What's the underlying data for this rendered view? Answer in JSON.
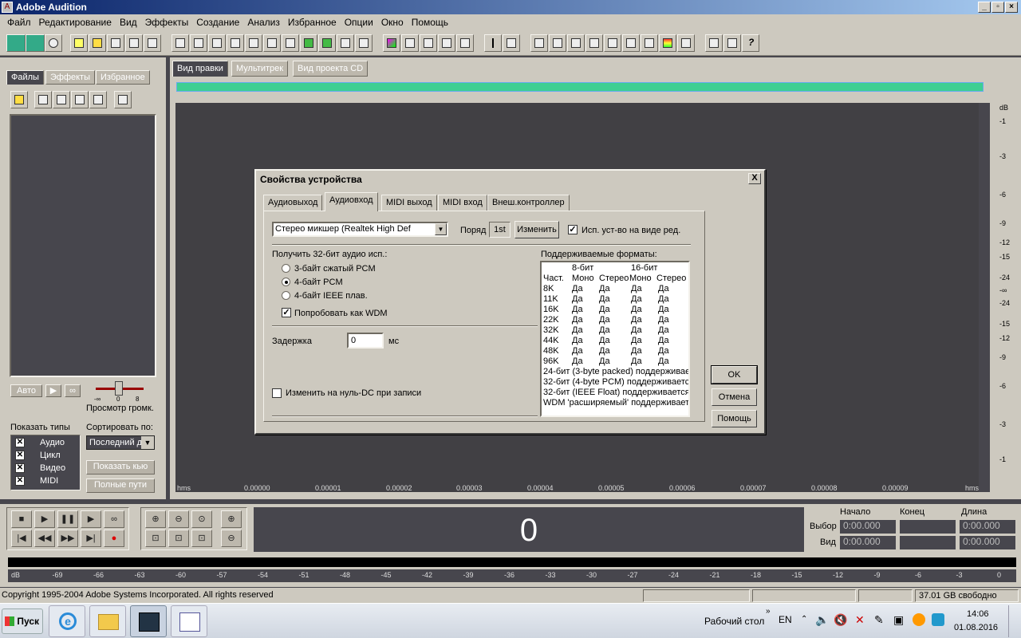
{
  "window": {
    "title": "Adobe Audition"
  },
  "menu": [
    "Файл",
    "Редактирование",
    "Вид",
    "Эффекты",
    "Создание",
    "Анализ",
    "Избранное",
    "Опции",
    "Окно",
    "Помощь"
  ],
  "left_panel": {
    "tabs": [
      "Файлы",
      "Эффекты",
      "Избранное"
    ],
    "auto_label": "Авто",
    "volume_label": "Просмотр громк.",
    "volume_scale": [
      "-∞",
      "0",
      "8"
    ],
    "show_types_label": "Показать типы",
    "sort_label": "Сортировать по:",
    "sort_value": "Последний д",
    "types": [
      "Аудио",
      "Цикл",
      "Видео",
      "MIDI"
    ],
    "show_button": "Показать кью",
    "paths_button": "Полные пути"
  },
  "main_tabs": [
    "Вид правки",
    "Мультитрек",
    "Вид проекта CD"
  ],
  "db_scale": [
    "dB",
    "-1",
    "-3",
    "-6",
    "-9",
    "-12",
    "-15",
    "-24",
    "-∞",
    "-24",
    "-15",
    "-12",
    "-9",
    "-6",
    "-3",
    "-1"
  ],
  "timeline": [
    "hms",
    "0.00000",
    "0.00001",
    "0.00002",
    "0.00003",
    "0.00004",
    "0.00005",
    "0.00006",
    "0.00007",
    "0.00008",
    "0.00009",
    "hms"
  ],
  "time_display": "0",
  "selection": {
    "headers": [
      "Начало",
      "Конец",
      "Длина"
    ],
    "rows": [
      {
        "label": "Выбор",
        "values": [
          "0:00.000",
          "",
          "0:00.000"
        ]
      },
      {
        "label": "Вид",
        "values": [
          "0:00.000",
          "",
          "0:00.000"
        ]
      }
    ]
  },
  "meter_scale": [
    "dB",
    "-69",
    "-66",
    "-63",
    "-60",
    "-57",
    "-54",
    "-51",
    "-48",
    "-45",
    "-42",
    "-39",
    "-36",
    "-33",
    "-30",
    "-27",
    "-24",
    "-21",
    "-18",
    "-15",
    "-12",
    "-9",
    "-6",
    "-3",
    "0"
  ],
  "status": {
    "copyright": "Copyright 1995-2004 Adobe Systems Incorporated. All rights reserved",
    "free_space": "37.01 GB свободно"
  },
  "taskbar": {
    "start": "Пуск",
    "desktop": "Рабочий стол",
    "lang": "EN",
    "time": "14:06",
    "date": "01.08.2016"
  },
  "dialog": {
    "title": "Свойства устройства",
    "close": "X",
    "tabs": [
      "Аудиовыход",
      "Аудиовход",
      "MIDI выход",
      "MIDI вход",
      "Внеш.контроллер"
    ],
    "active_tab": 1,
    "device_select": "Стерео микшер (Realtek High Def",
    "order_label": "Поряд",
    "order_value": "1st",
    "change_button": "Изменить",
    "use_device_label": "Исп. уст-во на виде ред.",
    "receive_label": "Получить 32-бит аудио исп.:",
    "radios": [
      "3-байт сжатый PCM",
      "4-байт PCM",
      "4-байт IEEE плав."
    ],
    "radio_selected": 1,
    "wdm_label": "Попробовать как WDM",
    "latency_label": "Задержка",
    "latency_value": "0",
    "latency_unit": "мс",
    "dc_label": "Изменить на нуль-DC при записи",
    "formats_label": "Поддерживаемые форматы:",
    "formats_header1": [
      "8-бит",
      "16-бит"
    ],
    "formats_header2": [
      "Част.",
      "Моно",
      "Стерео",
      "Моно",
      "Стерео"
    ],
    "formats_rows": [
      [
        "8K",
        "Да",
        "Да",
        "Да",
        "Да"
      ],
      [
        "11K",
        "Да",
        "Да",
        "Да",
        "Да"
      ],
      [
        "16K",
        "Да",
        "Да",
        "Да",
        "Да"
      ],
      [
        "22K",
        "Да",
        "Да",
        "Да",
        "Да"
      ],
      [
        "32K",
        "Да",
        "Да",
        "Да",
        "Да"
      ],
      [
        "44K",
        "Да",
        "Да",
        "Да",
        "Да"
      ],
      [
        "48K",
        "Да",
        "Да",
        "Да",
        "Да"
      ],
      [
        "96K",
        "Да",
        "Да",
        "Да",
        "Да"
      ]
    ],
    "formats_notes": [
      "24-бит (3-byte packed) поддерживае",
      "32-бит (4-byte PCM) поддерживаетс",
      "32-бит (IEEE Float) поддерживается",
      "WDM 'расширяемый' поддерживаетс"
    ],
    "ok": "OK",
    "cancel": "Отмена",
    "help": "Помощь"
  }
}
